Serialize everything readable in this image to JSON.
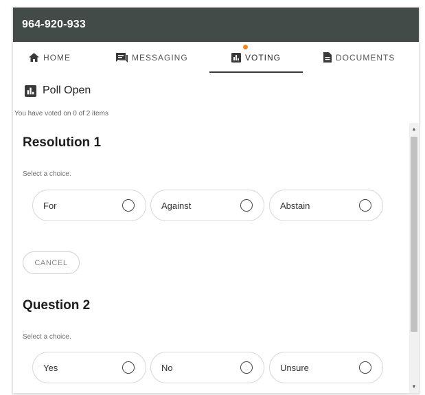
{
  "window": {
    "title": "964-920-933"
  },
  "tabs": [
    {
      "label": "HOME",
      "icon": "home-icon"
    },
    {
      "label": "MESSAGING",
      "icon": "chat-icon"
    },
    {
      "label": "VOTING",
      "icon": "poll-icon",
      "active": true,
      "notification": true
    },
    {
      "label": "DOCUMENTS",
      "icon": "document-icon"
    }
  ],
  "poll": {
    "status": "Poll Open",
    "progress": "You have voted on 0 of 2 items"
  },
  "items": [
    {
      "title": "Resolution 1",
      "hint": "Select a choice.",
      "choices": [
        "For",
        "Against",
        "Abstain"
      ],
      "cancel_label": "CANCEL"
    },
    {
      "title": "Question 2",
      "hint": "Select a choice.",
      "choices": [
        "Yes",
        "No",
        "Unsure"
      ]
    }
  ],
  "colors": {
    "titlebar": "#434b48",
    "notification": "#f08a24"
  }
}
